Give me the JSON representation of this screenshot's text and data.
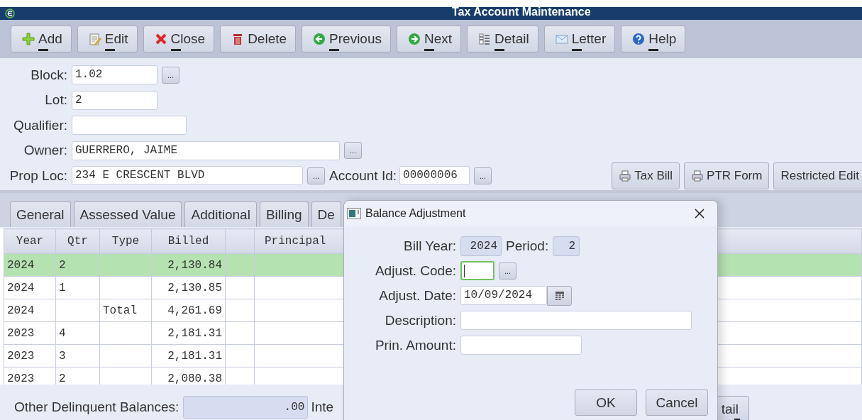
{
  "window": {
    "title": "Tax Account Maintenance"
  },
  "toolbar": [
    {
      "label": "Add",
      "mnemonic": true
    },
    {
      "label": "Edit",
      "mnemonic": true
    },
    {
      "label": "Close",
      "mnemonic": true
    },
    {
      "label": "Delete",
      "mnemonic": false
    },
    {
      "label": "Previous",
      "mnemonic": true
    },
    {
      "label": "Next",
      "mnemonic": true
    },
    {
      "label": "Detail",
      "mnemonic": true
    },
    {
      "label": "Letter",
      "mnemonic": true
    },
    {
      "label": "Help",
      "mnemonic": true
    }
  ],
  "form": {
    "block": {
      "label": "Block:",
      "value": "1.02"
    },
    "lot": {
      "label": "Lot:",
      "value": "2"
    },
    "qualifier": {
      "label": "Qualifier:"
    },
    "owner": {
      "label": "Owner:",
      "value": "GUERRERO, JAIME"
    },
    "prop_loc": {
      "label": "Prop Loc:",
      "value": "234 E CRESCENT BLVD"
    },
    "account_id": {
      "label": "Account Id:",
      "value": "00000006"
    },
    "ellipsis": "..."
  },
  "actions": [
    {
      "label": "Tax Bill"
    },
    {
      "label": "PTR Form"
    },
    {
      "label": "Restricted Edit"
    }
  ],
  "tabs": [
    {
      "label": "General",
      "selected": false
    },
    {
      "label": "Assessed Value",
      "selected": false
    },
    {
      "label": "Additional",
      "selected": false
    },
    {
      "label": "Billing",
      "selected": false
    },
    {
      "label": "De",
      "selected": false
    }
  ],
  "table": {
    "columns": [
      "Year",
      "Qtr",
      "Type",
      "Billed",
      "Principal"
    ],
    "rows": [
      {
        "year": "2024",
        "qtr": "2",
        "billed": "2,130.84",
        "selected": true
      },
      {
        "year": "2024",
        "qtr": "1",
        "billed": "2,130.85",
        "selected": false
      },
      {
        "year": "2024",
        "type": "Total",
        "billed": "4,261.69",
        "selected": false
      },
      {
        "year": "2023",
        "qtr": "4",
        "billed": "2,181.31",
        "selected": false
      },
      {
        "year": "2023",
        "qtr": "3",
        "billed": "2,181.31",
        "selected": false
      },
      {
        "year": "2023",
        "qtr": "2",
        "billed": "2,080.38",
        "selected": false
      }
    ]
  },
  "bottom": {
    "other_label": "Other Delinquent Balances:",
    "other_value": ".00",
    "interest_label": "Inte",
    "detail_button": "tail"
  },
  "dialog": {
    "title": "Balance Adjustment",
    "bill_year": {
      "label": "Bill Year:",
      "value": "2024"
    },
    "period": {
      "label": "Period:",
      "value": "2"
    },
    "adjust_code": {
      "label": "Adjust. Code:",
      "focused": true
    },
    "ellipsis": "...",
    "adjust_date": {
      "label": "Adjust. Date:",
      "value": "10/09/2024"
    },
    "description": {
      "label": "Description:"
    },
    "prin_amount": {
      "label": "Prin. Amount:"
    },
    "buttons": [
      "OK",
      "Cancel"
    ]
  }
}
